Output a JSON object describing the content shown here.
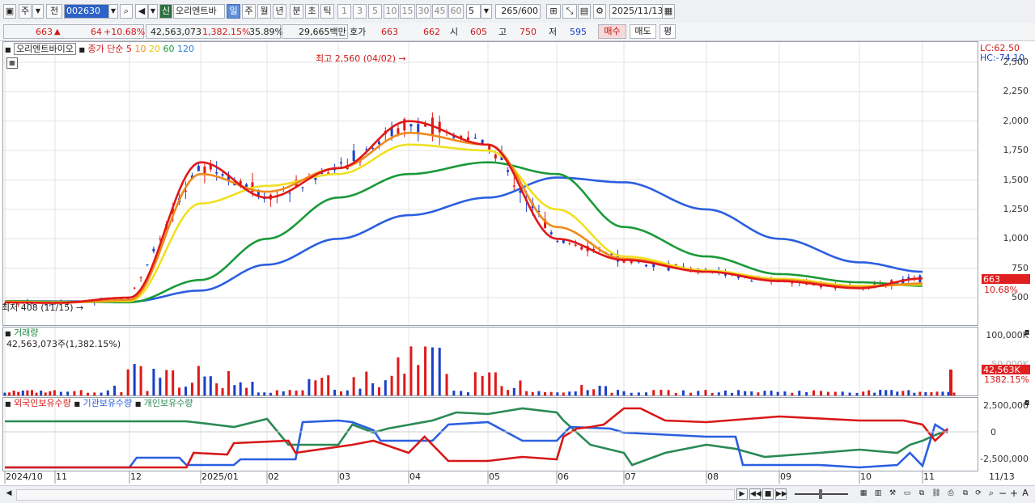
{
  "toolbar": {
    "market": "주",
    "compare": "전",
    "code": "002630",
    "stock_badge": "신",
    "stock_name": "오리엔트바",
    "periods": [
      "일",
      "주",
      "월",
      "년",
      "분",
      "초",
      "틱"
    ],
    "selected_period": "일",
    "intervals": [
      "1",
      "3",
      "5",
      "10",
      "15",
      "30",
      "45",
      "60"
    ],
    "interval_value": "5",
    "count_value": "265",
    "count_max": "/600",
    "date_value": "2025/11/13"
  },
  "quote": {
    "price": "663",
    "change": "64",
    "change_pct": "+10.68%",
    "volume": "42,563,073",
    "volume_pct": "1,382.15%",
    "turnover_pct": "35.89%",
    "amount": "29,665백만",
    "hoga_label": "호가",
    "ask": "663",
    "bid": "662",
    "open_label": "시",
    "open": "605",
    "high_label": "고",
    "high": "750",
    "low_label": "저",
    "low": "595",
    "buy_label": "매수",
    "sell_label": "매도",
    "avg_label": "평"
  },
  "price_panel": {
    "stock_label": "오리엔트바이오",
    "ma_label": "종가 단순",
    "ma_periods": [
      "5",
      "10",
      "20",
      "60",
      "120"
    ],
    "ma_colors": [
      "#e01818",
      "#f08a1c",
      "#f0e020",
      "#1a9a3a",
      "#2a5fe0"
    ],
    "high_annotation": "최고 2,560 (04/02)",
    "low_annotation": "최저 408 (11/15)",
    "lc_label": "LC:62.50",
    "hc_label": "HC:-74.10",
    "current_price_tag": "663",
    "current_pct_tag": "10.68%",
    "y_ticks": [
      "2,500",
      "2,250",
      "2,000",
      "1,750",
      "1,500",
      "1,250",
      "1,000",
      "750",
      "500"
    ]
  },
  "volume_panel": {
    "title": "거래량",
    "value_label": "42,563,073주(1,382.15%)",
    "y_ticks": [
      "100,000K",
      "50,000K"
    ],
    "current_tag": "42,563K",
    "current_pct_tag": "1382.15%"
  },
  "holdings_panel": {
    "series": [
      "외국인보유수량",
      "기관보유수량",
      "개인보유수량"
    ],
    "series_colors": [
      "#d81818",
      "#2a5fe0",
      "#2a8a55"
    ],
    "y_ticks": [
      "2,500,000",
      "0",
      "-2,500,000"
    ]
  },
  "x_axis": {
    "labels": [
      "2024/10",
      "11",
      "12",
      "2025/01",
      "02",
      "03",
      "04",
      "05",
      "06",
      "07",
      "08",
      "09",
      "10",
      "11"
    ],
    "current_date": "11/13"
  },
  "chart_data": {
    "type": "line",
    "title": "오리엔트바이오",
    "x": [
      "2024/10",
      "2024/11",
      "2024/12",
      "2025/01",
      "2025/02",
      "2025/03",
      "2025/04",
      "2025/05",
      "2025/06",
      "2025/07",
      "2025/08",
      "2025/09",
      "2025/10",
      "2025/11"
    ],
    "series": [
      {
        "name": "5",
        "values": [
          460,
          455,
          500,
          1650,
          1350,
          1600,
          2000,
          1800,
          1000,
          820,
          720,
          640,
          580,
          663
        ]
      },
      {
        "name": "10",
        "values": [
          460,
          455,
          480,
          1550,
          1400,
          1600,
          1900,
          1800,
          1100,
          830,
          720,
          650,
          590,
          620
        ]
      },
      {
        "name": "20",
        "values": [
          465,
          460,
          470,
          1300,
          1450,
          1550,
          1800,
          1750,
          1250,
          850,
          730,
          660,
          600,
          610
        ]
      },
      {
        "name": "60",
        "values": [
          470,
          465,
          460,
          650,
          1000,
          1350,
          1550,
          1650,
          1550,
          1100,
          850,
          700,
          630,
          600
        ]
      },
      {
        "name": "120",
        "values": [
          470,
          468,
          465,
          560,
          780,
          1000,
          1200,
          1350,
          1520,
          1480,
          1250,
          1000,
          800,
          720
        ]
      }
    ],
    "ylim": [
      408,
      2560
    ]
  }
}
